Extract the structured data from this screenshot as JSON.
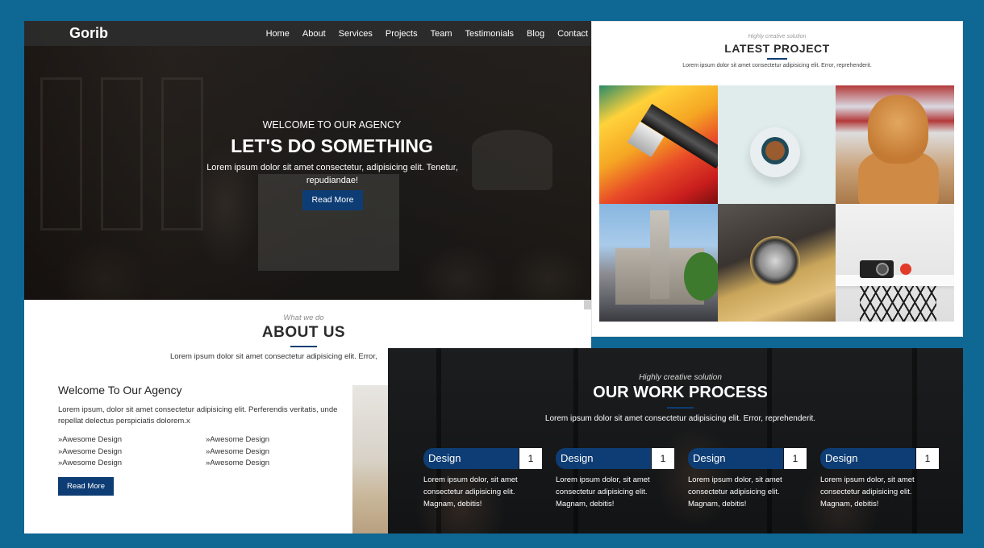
{
  "colors": {
    "background": "#0f6793",
    "accent": "#0d3d74"
  },
  "navbar": {
    "logo": "Gorib",
    "links": [
      "Home",
      "About",
      "Services",
      "Projects",
      "Team",
      "Testimonials",
      "Blog",
      "Contact"
    ]
  },
  "hero": {
    "subtitle": "WELCOME TO OUR AGENCY",
    "title": "LET'S DO SOMETHING",
    "text": "Lorem ipsum dolor sit amet consectetur, adipisicing elit. Tenetur, repudiandae!",
    "button": "Read More"
  },
  "about": {
    "subtitle": "What we do",
    "title": "ABOUT US",
    "description": "Lorem ipsum dolor sit amet consectetur adipisicing elit. Error,",
    "heading": "Welcome To Our Agency",
    "text": "Lorem ipsum, dolor sit amet consectetur adipisicing elit. Perferendis veritatis, unde repellat delectus perspiciatis dolorem.x",
    "features": [
      "»Awesome Design",
      "»Awesome Design",
      "»Awesome Design",
      "»Awesome Design",
      "»Awesome Design",
      "»Awesome Design"
    ],
    "button": "Read More"
  },
  "projects": {
    "subtitle": "Highly creative solution",
    "title": "LATEST PROJECT",
    "description": "Lorem ipsum dolor sit amet consectetur adipisicing elit. Error, reprehenderit.",
    "images": [
      "paintbrush-image",
      "coffee-cup-image",
      "golden-retriever-image",
      "city-hall-image",
      "vintage-car-headlight-image",
      "camera-on-chair-image"
    ]
  },
  "work_process": {
    "subtitle": "Highly creative solution",
    "title": "OUR WORK PROCESS",
    "description": "Lorem ipsum dolor sit amet consectetur adipisicing elit. Error, reprehenderit.",
    "cards": [
      {
        "label": "Design",
        "number": "1",
        "text": "Lorem ipsum dolor, sit amet consectetur adipisicing elit. Magnam, debitis!"
      },
      {
        "label": "Design",
        "number": "1",
        "text": "Lorem ipsum dolor, sit amet consectetur adipisicing elit. Magnam, debitis!"
      },
      {
        "label": "Design",
        "number": "1",
        "text": "Lorem ipsum dolor, sit amet consectetur adipisicing elit. Magnam, debitis!"
      },
      {
        "label": "Design",
        "number": "1",
        "text": "Lorem ipsum dolor, sit amet consectetur adipisicing elit. Magnam, debitis!"
      }
    ]
  }
}
